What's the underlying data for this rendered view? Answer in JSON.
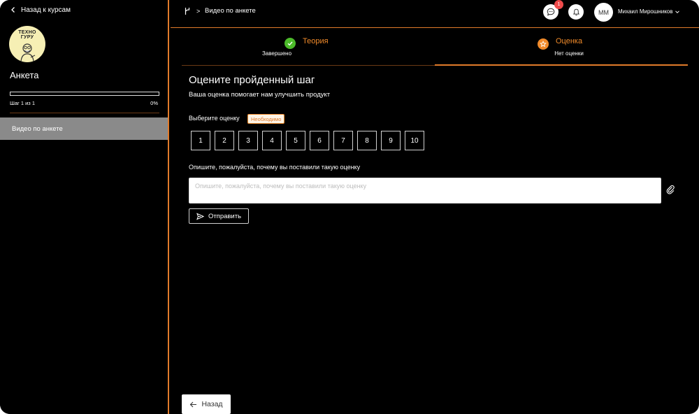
{
  "sidebar": {
    "back_label": "Назад к курсам",
    "logo_text_line1": "ТЕХНО",
    "logo_text_line2": "ГУРУ",
    "course_title": "Анкета",
    "progress": {
      "step_text": "Шаг 1 из 1",
      "percent_text": "0%",
      "fraction": 0
    },
    "items": [
      {
        "label": "Видео по анкете",
        "active": true
      }
    ]
  },
  "header": {
    "breadcrumb_separator": ">",
    "breadcrumb_text": "Видео по анкете",
    "chat_badge_count": "1",
    "user_initials": "ММ",
    "user_name": "Михаил Мирошников"
  },
  "steps": [
    {
      "title": "Теория",
      "status": "Завершено",
      "icon": "check-icon",
      "color": "#4cbb2a"
    },
    {
      "title": "Оценка",
      "status": "Нет оценки",
      "icon": "star-icon",
      "color": "#f08a2a"
    }
  ],
  "rating": {
    "heading": "Оцените пройденный шаг",
    "subheading": "Ваша оценка помогает нам улучшить продукт",
    "scale_label": "Выберите оценку",
    "required_label": "Необходимо",
    "scale": [
      "1",
      "2",
      "3",
      "4",
      "5",
      "6",
      "7",
      "8",
      "9",
      "10"
    ],
    "comment_label": "Опишите, пожалуйста, почему вы поставили такую оценку",
    "comment_placeholder": "Опишите, пожалуйста, почему вы поставили такую оценку",
    "comment_value": "",
    "send_label": "Отправить"
  },
  "footer": {
    "back_label": "Назад"
  },
  "colors": {
    "accent": "#e07a2a",
    "success": "#4cbb2a",
    "badge": "#ef4b4b",
    "background": "#000000"
  }
}
